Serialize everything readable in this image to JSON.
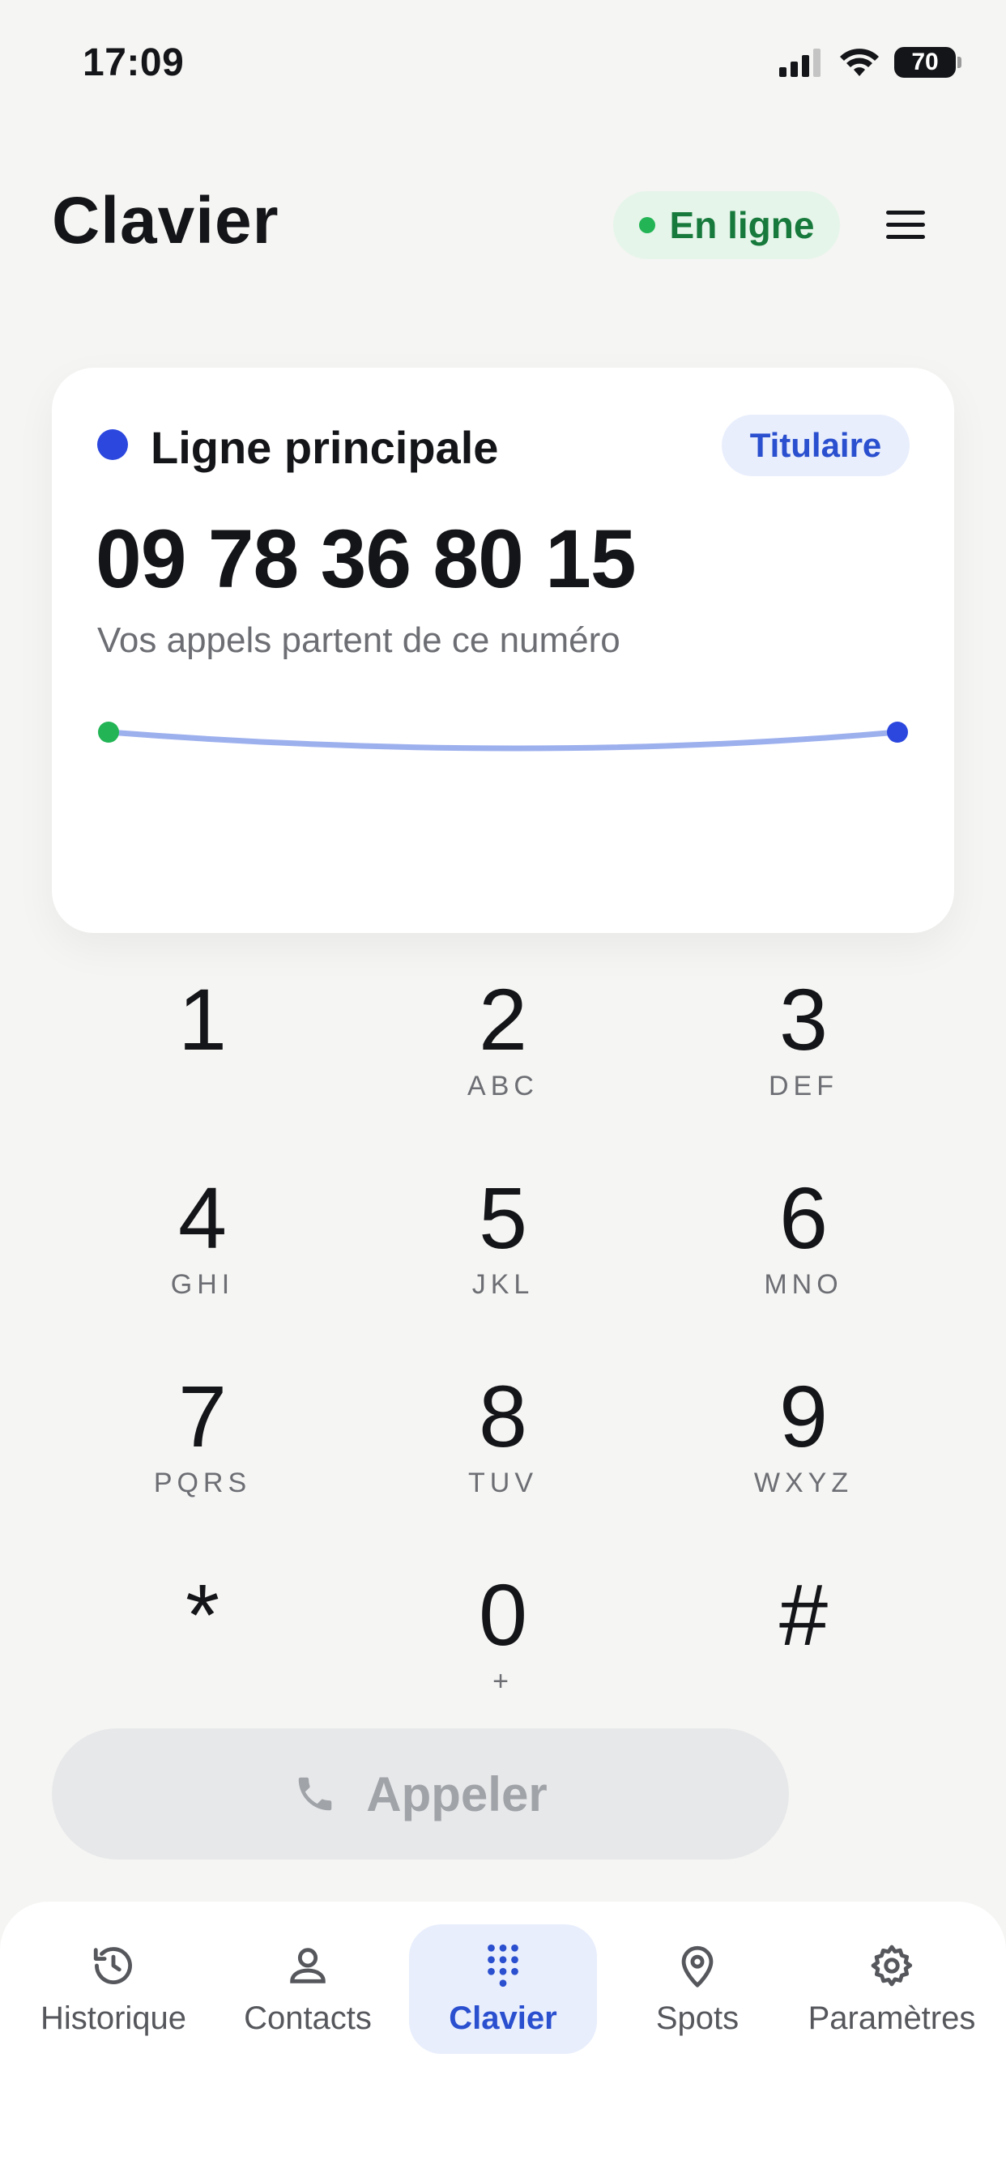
{
  "status_bar": {
    "time": "17:09",
    "battery": "70"
  },
  "header": {
    "title": "Clavier",
    "status_label": "En ligne"
  },
  "line_card": {
    "name": "Ligne principale",
    "badge": "Titulaire",
    "number": "09 78 36 80 15",
    "subtitle": "Vos appels partent de ce numéro"
  },
  "dialpad": {
    "keys": [
      {
        "digit": "1",
        "letters": ""
      },
      {
        "digit": "2",
        "letters": "ABC"
      },
      {
        "digit": "3",
        "letters": "DEF"
      },
      {
        "digit": "4",
        "letters": "GHI"
      },
      {
        "digit": "5",
        "letters": "JKL"
      },
      {
        "digit": "6",
        "letters": "MNO"
      },
      {
        "digit": "7",
        "letters": "PQRS"
      },
      {
        "digit": "8",
        "letters": "TUV"
      },
      {
        "digit": "9",
        "letters": "WXYZ"
      },
      {
        "digit": "*",
        "letters": ""
      },
      {
        "digit": "0",
        "letters": "+"
      },
      {
        "digit": "#",
        "letters": ""
      }
    ]
  },
  "call_button": {
    "label": "Appeler"
  },
  "bottom_nav": {
    "items": [
      {
        "label": "Historique",
        "icon": "history-icon"
      },
      {
        "label": "Contacts",
        "icon": "person-icon"
      },
      {
        "label": "Clavier",
        "icon": "dialpad-icon",
        "active": true
      },
      {
        "label": "Spots",
        "icon": "map-pin-icon"
      },
      {
        "label": "Paramètres",
        "icon": "gear-icon"
      }
    ]
  },
  "colors": {
    "accent": "#2b47de",
    "online": "#22b455",
    "background": "#f5f5f3"
  }
}
